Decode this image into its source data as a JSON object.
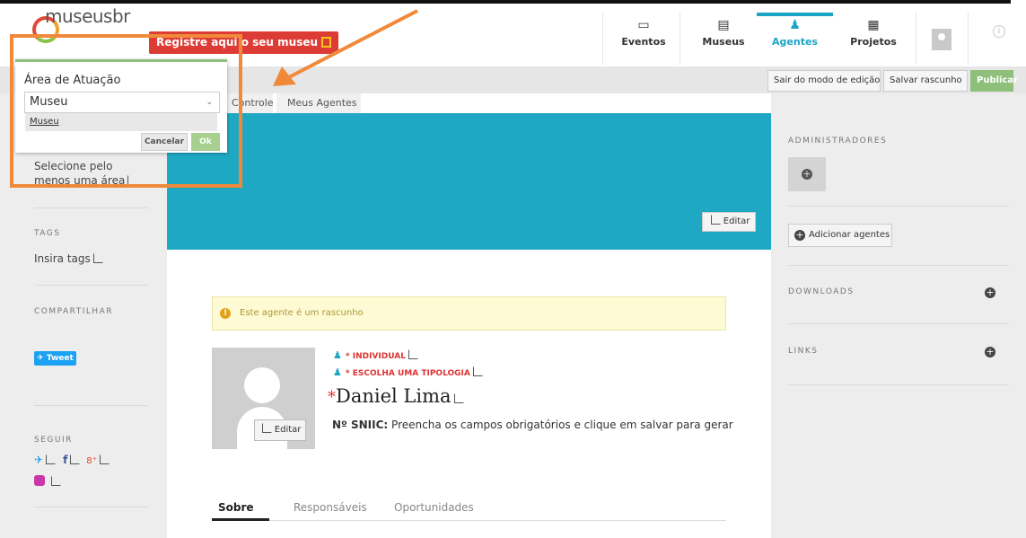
{
  "header": {
    "logo_text": "museusbr",
    "register_button": "Registre aqui o seu museu",
    "nav": [
      {
        "label": "Eventos",
        "icon": "calendar-icon"
      },
      {
        "label": "Museus",
        "icon": "building-icon"
      },
      {
        "label": "Agentes",
        "icon": "person-icon",
        "active": true
      },
      {
        "label": "Projetos",
        "icon": "clipboard-icon"
      }
    ]
  },
  "editbar": {
    "exit_edit": "Sair do modo de edição",
    "save_draft": "Salvar rascunho",
    "publish": "Publicar"
  },
  "breadcrumb": [
    "Controle",
    "Meus Agentes"
  ],
  "cover": {
    "edit_label": "Editar",
    "color": "#1fa8c3"
  },
  "left_sidebar": {
    "area_hint": "Selecione pelo menos uma área",
    "tags_heading": "TAGS",
    "tags_placeholder": "Insira tags",
    "share_heading": "COMPARTILHAR",
    "tweet_label": "Tweet",
    "follow_heading": "SEGUIR"
  },
  "main": {
    "alert_text": "Este agente é um rascunho",
    "type_label": "INDIVIDUAL",
    "typology_label": "ESCOLHA UMA TIPOLOGIA",
    "name_asterisk": "*",
    "name": "Daniel Lima",
    "photo_edit_label": "Editar",
    "sniic_label": "Nº SNIIC:",
    "sniic_value": "Preencha os campos obrigatórios e clique em salvar para gerar",
    "tabs": [
      "Sobre",
      "Responsáveis",
      "Oportunidades"
    ]
  },
  "right_sidebar": {
    "admins_heading": "ADMINISTRADORES",
    "add_agents": "Adicionar agentes",
    "downloads_heading": "DOWNLOADS",
    "links_heading": "LINKS"
  },
  "popup": {
    "label": "Área de Atuação",
    "select_value": "Museu",
    "option": "Museu",
    "cancel": "Cancelar",
    "ok": "Ok"
  },
  "colors": {
    "accent": "#1ba4c4",
    "annotation": "#f08a3a",
    "publish": "#8ec07b",
    "register": "#dd3b35"
  }
}
